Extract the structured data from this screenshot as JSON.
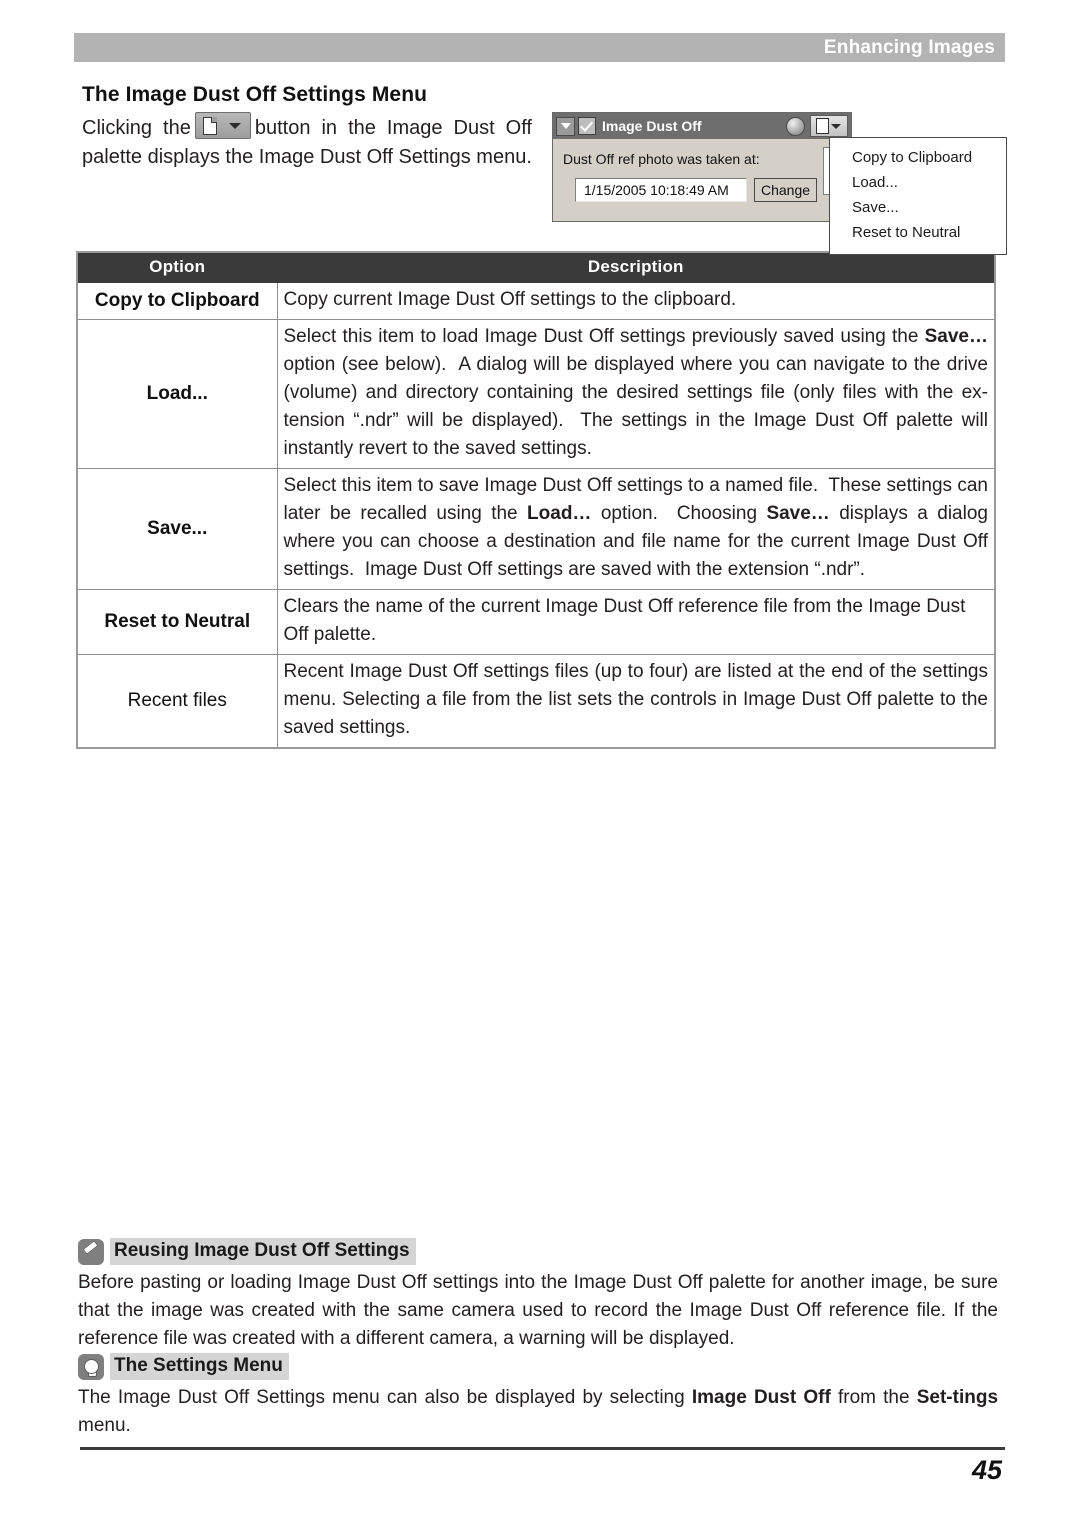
{
  "header": {
    "running_title": "Enhancing Images"
  },
  "section": {
    "title": "The Image Dust Off Settings Menu",
    "intro_before": "Clicking the",
    "intro_after": "button in the Image Dust Off palette displays the Image Dust Off Settings menu.",
    "inline_button_icon": "document-dropdown-icon"
  },
  "figure": {
    "palette": {
      "expand_icon": "triangle-down-icon",
      "checkbox_icon": "checkbox-checked-icon",
      "title": "Image Dust Off",
      "knob_icon": "circle-knob-icon",
      "settings_button_icon": "document-dropdown-icon",
      "label": "Dust Off ref photo was taken at:",
      "date_value": "1/15/2005 10:18:49 AM",
      "change_button": "Change"
    },
    "menu": {
      "items": [
        "Copy to Clipboard",
        "Load...",
        "Save...",
        "Reset to Neutral"
      ]
    }
  },
  "table": {
    "headers": [
      "Option",
      "Description"
    ],
    "rows": [
      {
        "option": "Copy to Clipboard",
        "option_bold": true,
        "description": "Copy current Image Dust Off settings to the clipboard."
      },
      {
        "option": "Load...",
        "option_bold": true,
        "description": "Select this item to load Image Dust Off settings previously saved using the Save... option (see below).  A dialog will be displayed where you can navigate to the drive (volume) and directory containing the desired settings file (only files with the extension “.ndr” will be displayed).  The settings in the Image Dust Off palette will instantly revert to the saved settings."
      },
      {
        "option": "Save...",
        "option_bold": true,
        "description": "Select this item to save Image Dust Off settings to a named file.  These settings can later be recalled using the Load... option.  Choosing Save... displays a dialog where you can choose a destination and file name for the current Image Dust Off settings.  Image Dust Off settings are saved with the extension “.ndr”."
      },
      {
        "option": "Reset to Neutral",
        "option_bold": true,
        "description": "Clears the name of the current Image Dust Off reference file from the Image Dust Off palette."
      },
      {
        "option": "Recent files",
        "option_bold": false,
        "description": "Recent Image Dust Off settings files (up to four) are listed at the end of the settings menu.  Selecting a file from the list sets the controls in Image Dust Off palette to the saved settings."
      }
    ]
  },
  "notes": [
    {
      "icon": "pencil-icon",
      "title": "Reusing Image Dust Off Settings",
      "body": "Before pasting or loading Image Dust Off settings into the Image Dust Off palette for another image, be sure that the image was created with the same camera used to record the Image Dust Off reference file.  If the reference file was created with a different camera, a warning will be displayed."
    },
    {
      "icon": "lightbulb-icon",
      "title": "The Settings Menu",
      "body": "The Image Dust Off Settings menu can also be displayed by selecting Image Dust Off from the Settings menu."
    }
  ],
  "footer": {
    "page_number": "45"
  },
  "colors": {
    "header_band": "#b3b3b3",
    "table_header": "#3a3a3a",
    "note_highlight": "#d5d5d5",
    "palette_titlebar": "#6e6e6e",
    "palette_body": "#d4d0c8"
  }
}
